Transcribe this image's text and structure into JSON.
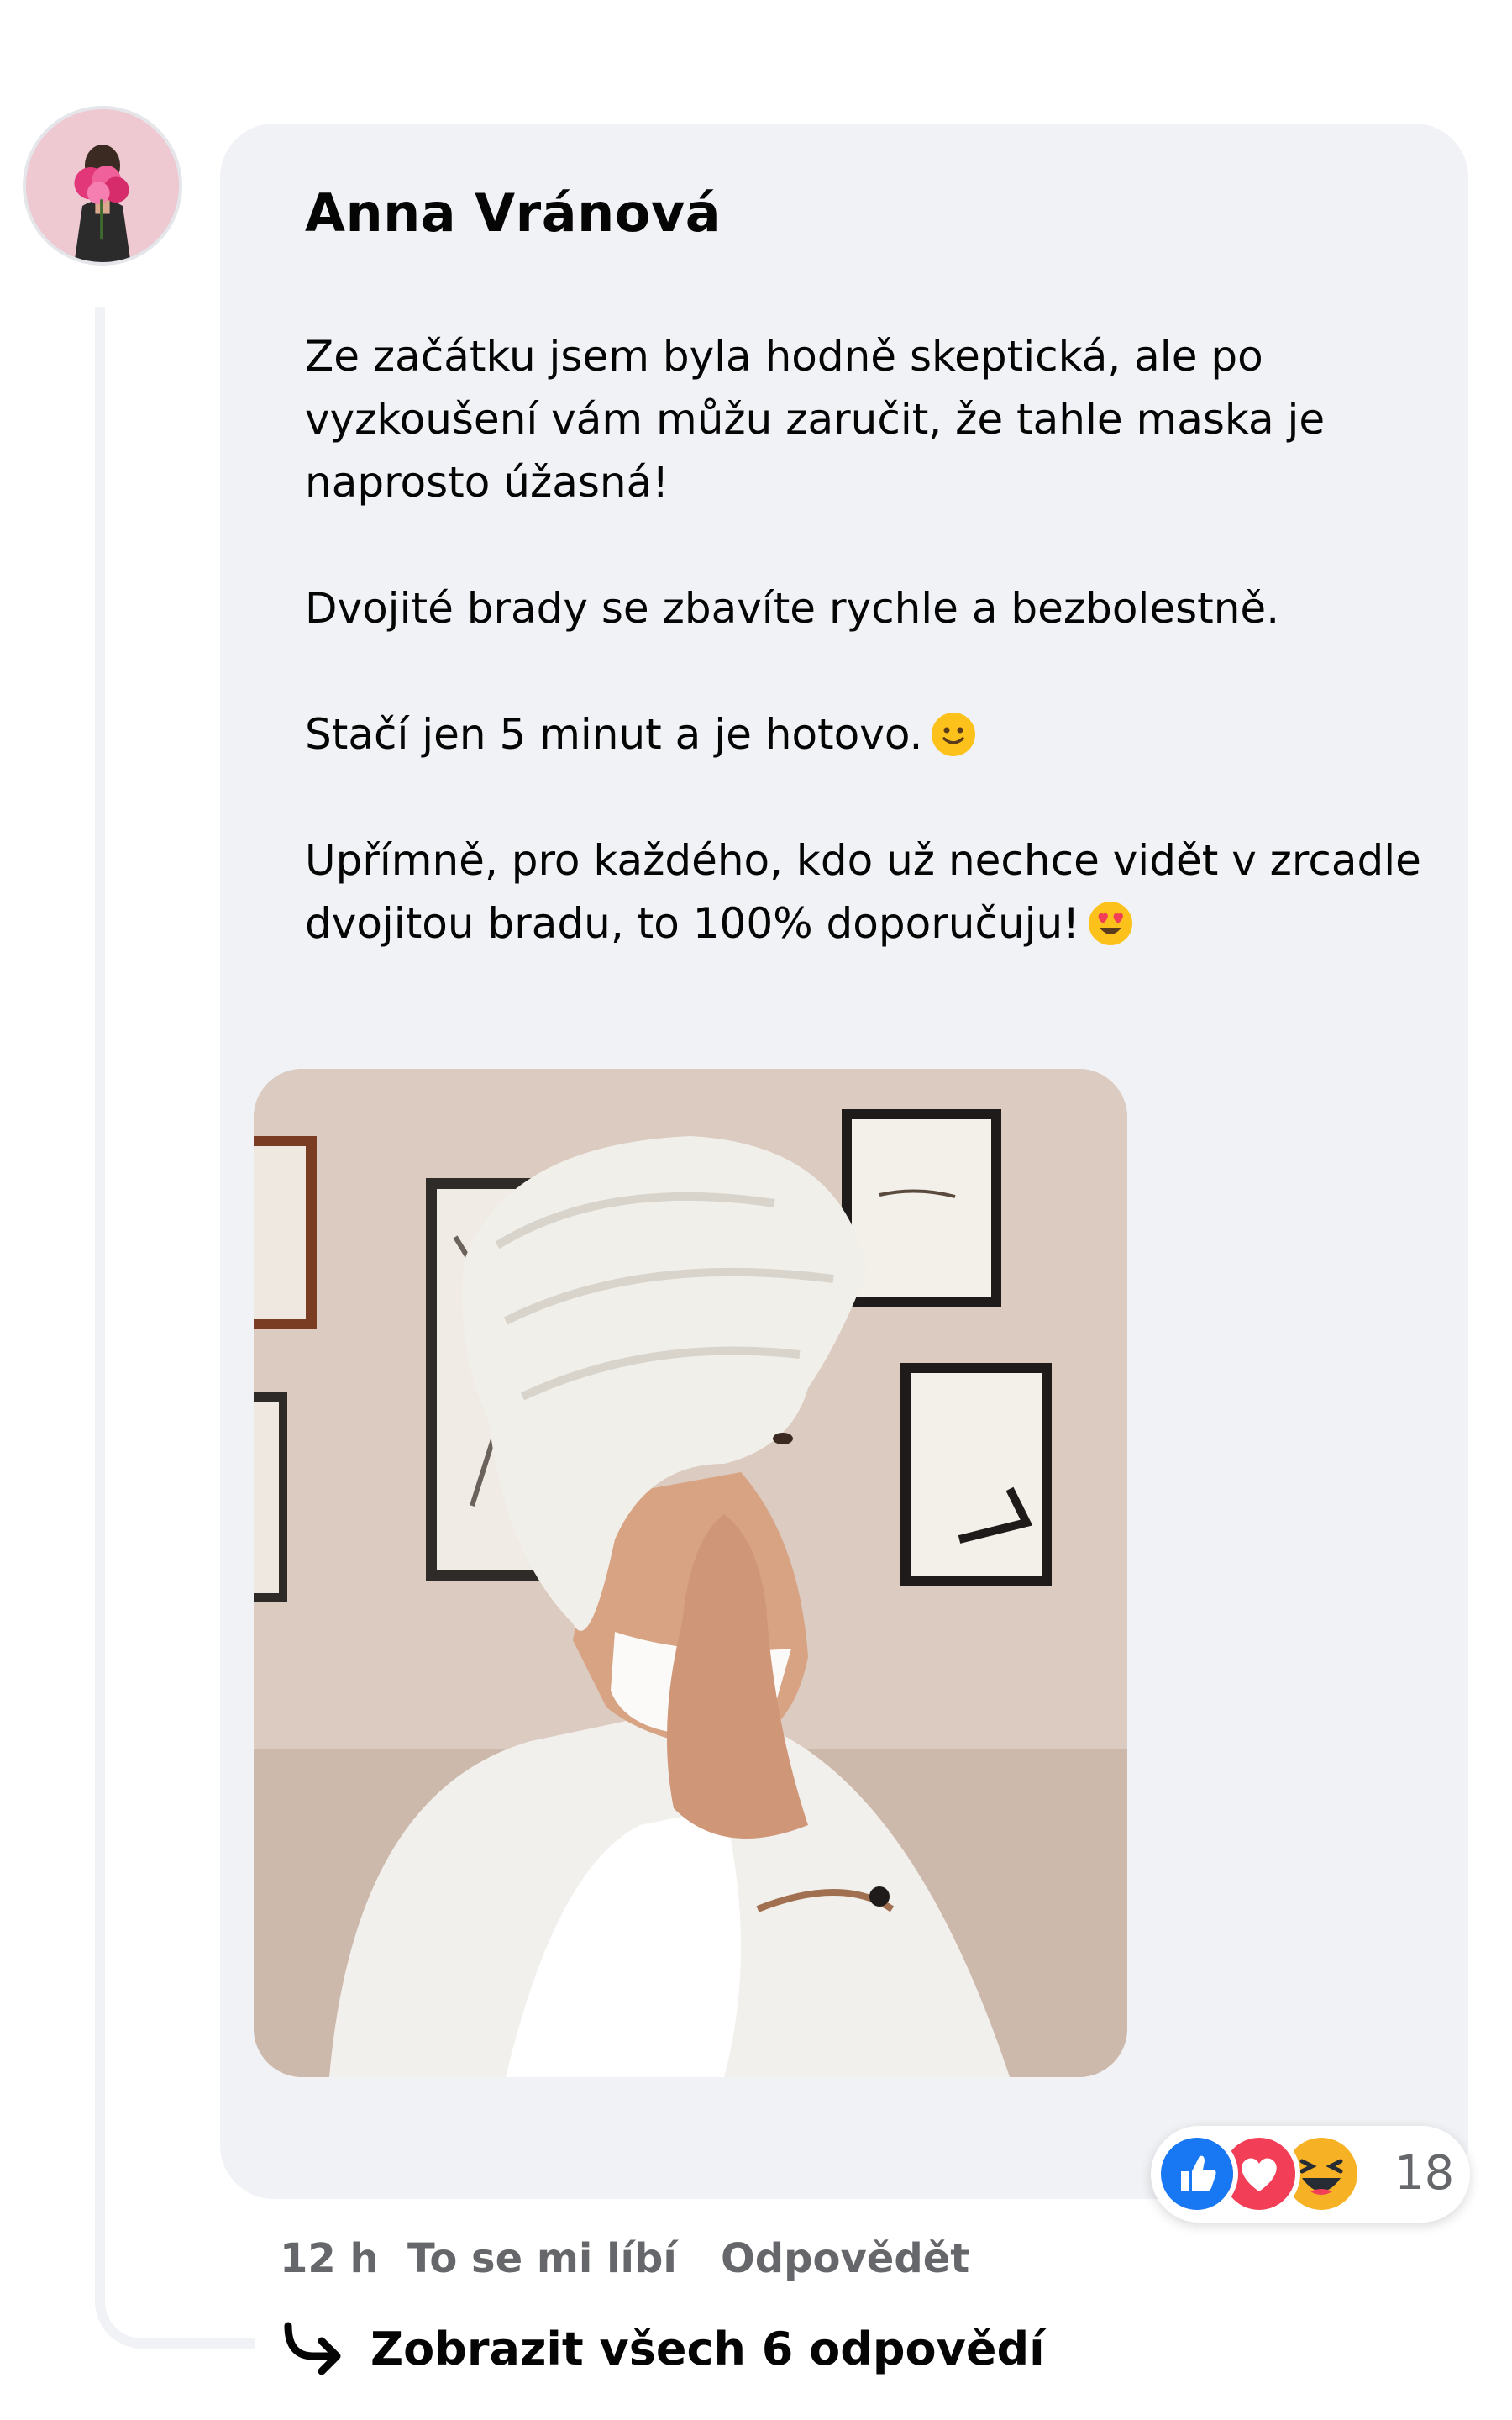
{
  "comment": {
    "author": "Anna Vránová",
    "paragraphs": [
      "Ze začátku jsem byla hodně skeptická, ale po vyzkoušení vám můžu zaručit, že tahle maska je naprosto úžasná!",
      "Dvojité brady se zbavíte rychle a bezbolestně.",
      "Stačí jen 5 minut a je hotovo.",
      "Upřímně, pro každého, kdo už nechce vidět v zrcadle dvojitou bradu, to 100% doporučuju!"
    ],
    "emojis": [
      "slightly-smiling-face",
      "heart-eyes-face"
    ],
    "reactions": {
      "types": [
        "like",
        "love",
        "haha"
      ],
      "count": "18",
      "colors": {
        "like": "#1877f2",
        "love": "#f33e58",
        "haha": "#f7b125"
      }
    },
    "time": "12 h",
    "like_label": "To se mi líbí",
    "reply_label": "Odpovědět",
    "view_replies_label": "Zobrazit všech 6 odpovědí"
  },
  "theme": {
    "bubble_bg": "#f0f2f5",
    "text": "#050505",
    "secondary_text": "#65676b"
  }
}
